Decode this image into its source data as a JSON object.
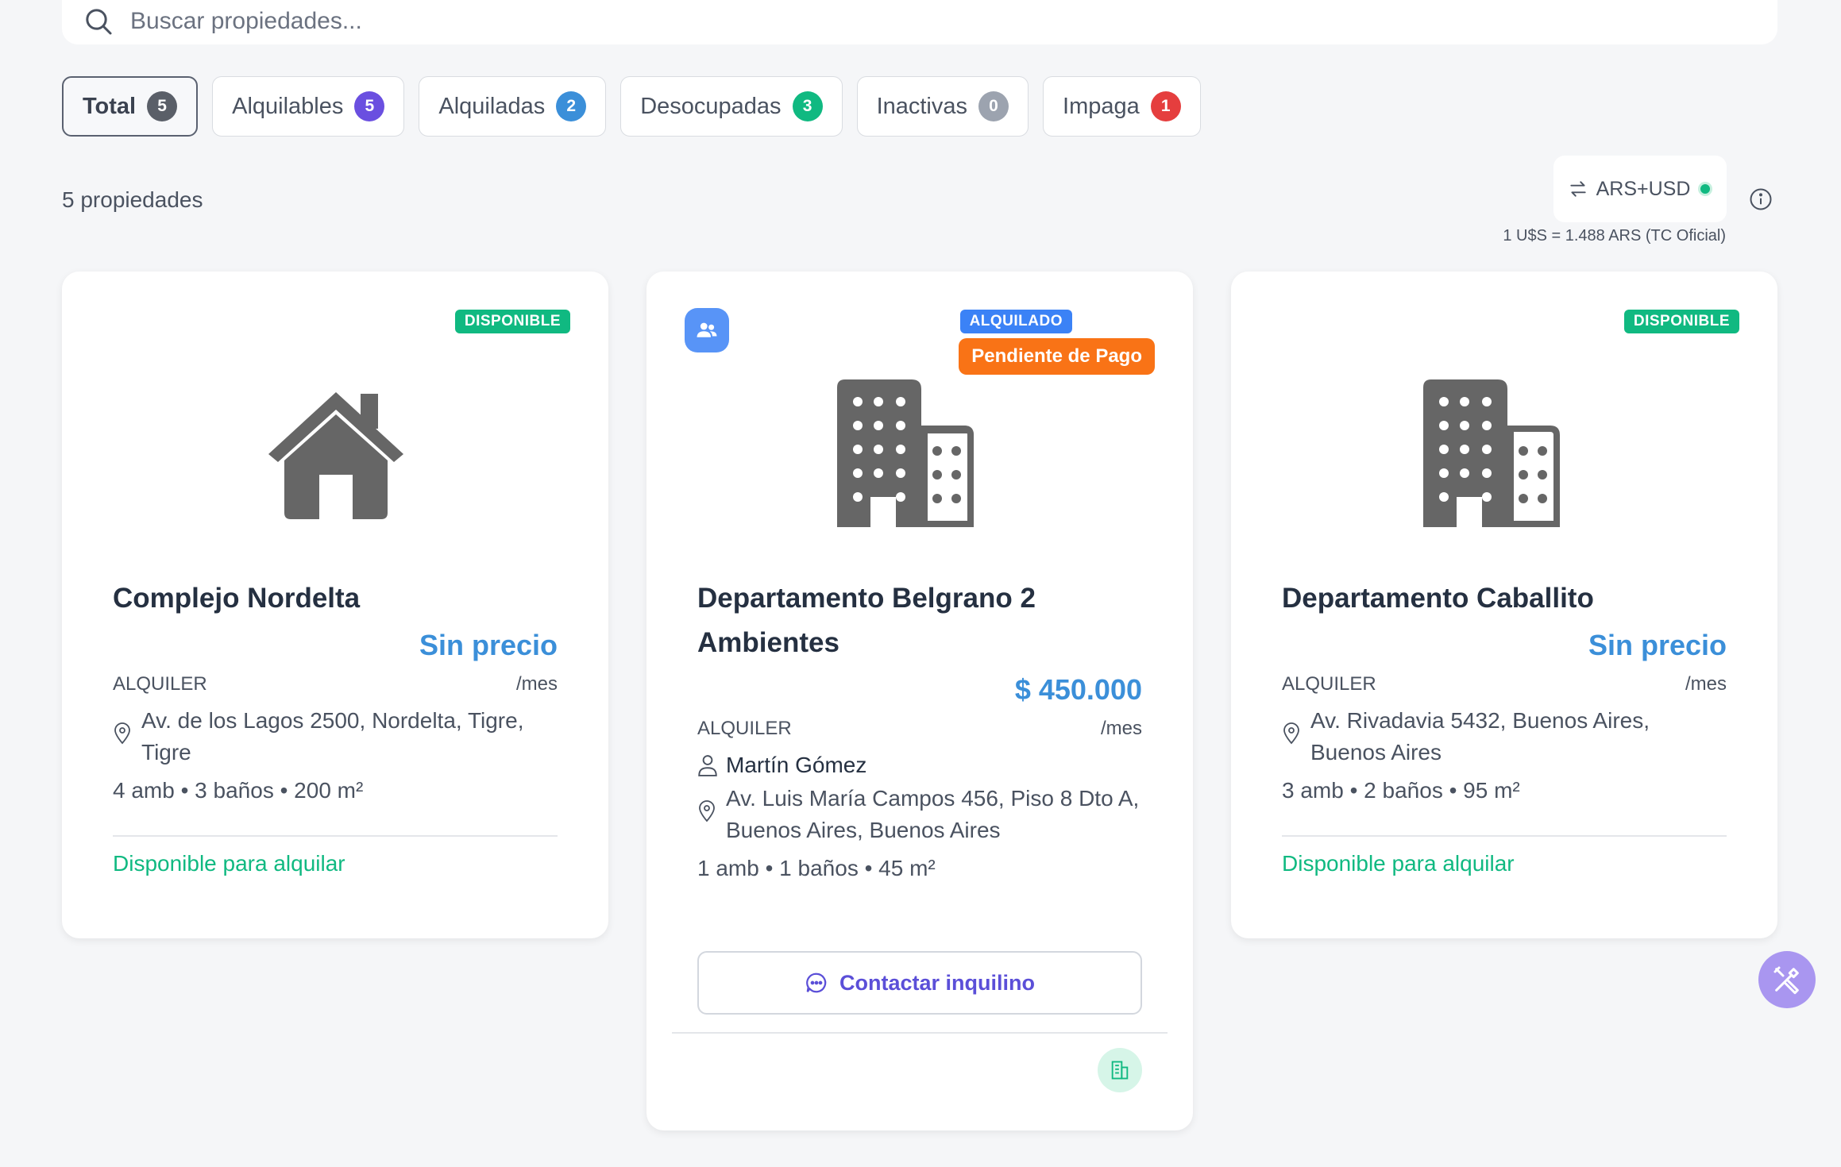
{
  "search": {
    "placeholder": "Buscar propiedades..."
  },
  "filters": [
    {
      "label": "Total",
      "count": "5",
      "color": "#5a5f68",
      "active": true
    },
    {
      "label": "Alquilables",
      "count": "5",
      "color": "#6a4fe0"
    },
    {
      "label": "Alquiladas",
      "count": "2",
      "color": "#3b8fd9"
    },
    {
      "label": "Desocupadas",
      "count": "3",
      "color": "#10b981"
    },
    {
      "label": "Inactivas",
      "count": "0",
      "color": "#9ca3af"
    },
    {
      "label": "Impaga",
      "count": "1",
      "color": "#e53e3e"
    }
  ],
  "summary": {
    "count_text": "5 propiedades"
  },
  "currency": {
    "label": "ARS+USD",
    "rate": "1 U$S = 1.488 ARS (TC Oficial)"
  },
  "cards": [
    {
      "status": "DISPONIBLE",
      "status_color": "#10b981",
      "icon": "house-icon",
      "title": "Complejo Nordelta",
      "price": "Sin precio",
      "type": "ALQUILER",
      "period": "/mes",
      "address": "Av. de los Lagos 2500, Nordelta, Tigre, Tigre",
      "specs": "4 amb • 3 baños • 200 m²",
      "availability": "Disponible para alquilar"
    },
    {
      "status": "ALQUILADO",
      "status_color": "#3b82f6",
      "payment_status": "Pendiente de Pago",
      "icon": "building-icon",
      "title": "Departamento Belgrano 2 Ambientes",
      "price": "$ 450.000",
      "type": "ALQUILER",
      "period": "/mes",
      "tenant": "Martín Gómez",
      "address": "Av. Luis María Campos 456, Piso 8 Dto A, Buenos Aires, Buenos Aires",
      "specs": "1 amb • 1 baños • 45 m²",
      "contact_label": "Contactar inquilino"
    },
    {
      "status": "DISPONIBLE",
      "status_color": "#10b981",
      "icon": "building-icon",
      "title": "Departamento Caballito",
      "price": "Sin precio",
      "type": "ALQUILER",
      "period": "/mes",
      "address": "Av. Rivadavia 5432, Buenos Aires, Buenos Aires",
      "specs": "3 amb • 2 baños • 95 m²",
      "availability": "Disponible para alquilar"
    }
  ]
}
